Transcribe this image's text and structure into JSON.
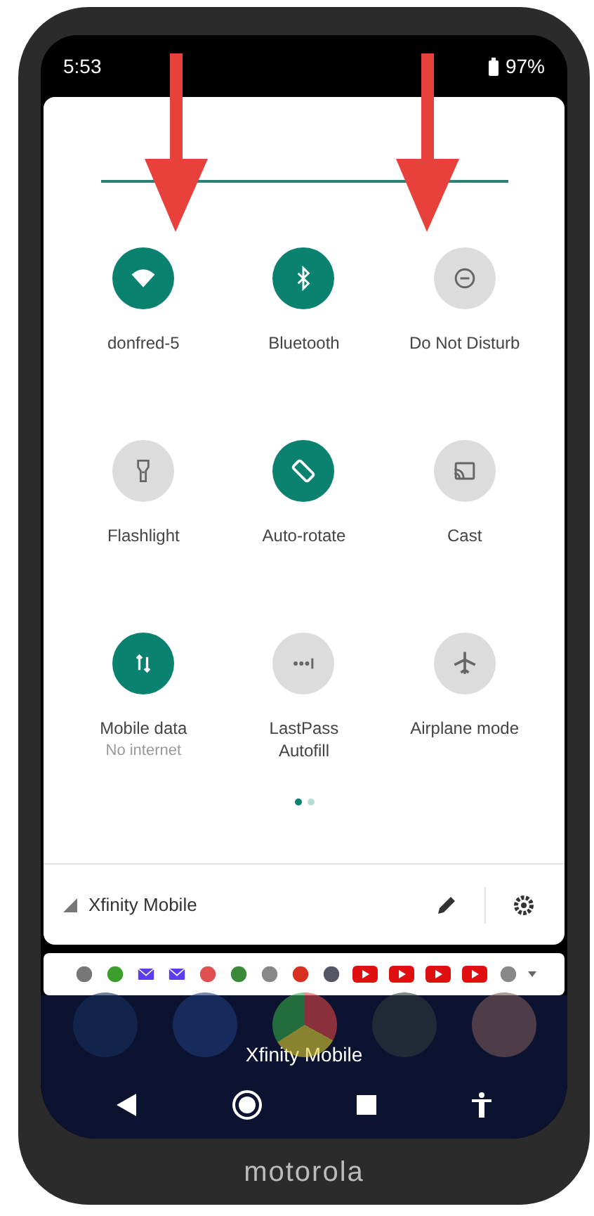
{
  "status_bar": {
    "time": "5:53",
    "battery": "97%"
  },
  "tiles": [
    {
      "label": "donfred-5",
      "on": true
    },
    {
      "label": "Bluetooth",
      "on": true
    },
    {
      "label": "Do Not Disturb",
      "on": false
    },
    {
      "label": "Flashlight",
      "on": false
    },
    {
      "label": "Auto-rotate",
      "on": true
    },
    {
      "label": "Cast",
      "on": false
    },
    {
      "label": "Mobile data",
      "sublabel": "No internet",
      "on": true
    },
    {
      "label": "LastPass Autofill",
      "on": false
    },
    {
      "label": "Airplane mode",
      "on": false
    }
  ],
  "page_dots": [
    {
      "selected": true
    },
    {
      "selected": false
    }
  ],
  "footer": {
    "carrier": "Xfinity Mobile"
  },
  "home": {
    "label": "Xfinity Mobile"
  },
  "brand": "motorola"
}
